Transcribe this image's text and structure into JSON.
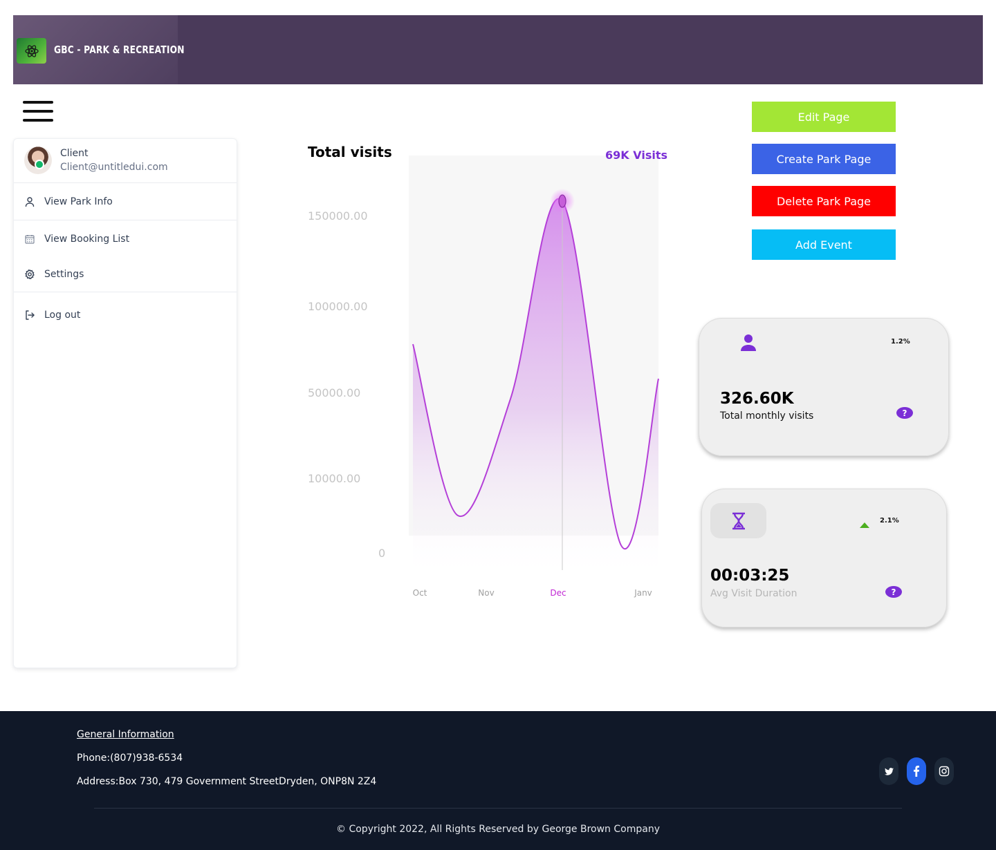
{
  "header": {
    "logo_text": "GBC - PARK & RECREATION",
    "background": "#4a3a5a"
  },
  "sidebar": {
    "user": {
      "name": "Client",
      "email": "Client@untitledui.com"
    },
    "items": [
      {
        "label": "View Park Info",
        "icon": "user-icon"
      },
      {
        "label": "View Booking List",
        "icon": "calendar-icon"
      },
      {
        "label": "Settings",
        "icon": "gear-icon"
      },
      {
        "label": "Log out",
        "icon": "logout-icon"
      }
    ]
  },
  "chart": {
    "title": "Total visits",
    "peak_label": "69K Visits"
  },
  "chart_data": {
    "type": "area",
    "title": "Total visits",
    "y_tick_labels": [
      "150000.00",
      "100000.00",
      "50000.00",
      "10000.00",
      "0"
    ],
    "x_tick_labels": [
      "Oct",
      "Nov",
      "Dec",
      "Janv"
    ],
    "highlighted_category": "Dec",
    "annotation": "69K Visits",
    "series": [
      {
        "values": [
          {
            "x": "Oct",
            "y": 78000
          },
          {
            "x": "Oct-Nov",
            "y": 5000
          },
          {
            "x": "Nov",
            "y": 40000
          },
          {
            "x": "Nov-Dec",
            "y": 47000
          },
          {
            "x": "Dec",
            "y": 158000
          },
          {
            "x": "Dec-Janv",
            "y": 1000
          },
          {
            "x": "Janv",
            "y": 58000
          }
        ]
      }
    ],
    "colors": {
      "line": "#b43fd8",
      "fill": "#d9a3ec",
      "highlight": "#c026d3",
      "grid": "#eeeeee"
    },
    "grid": false
  },
  "actions": {
    "edit": "Edit Page",
    "create": "Create Park Page",
    "delete": "Delete Park Page",
    "add_event": "Add Event"
  },
  "action_colors": {
    "edit": "#a3e635",
    "create": "#3b63e6",
    "delete": "#ff0000",
    "add_event": "#06bdf5"
  },
  "stats": {
    "visits": {
      "value": "326.60K",
      "label": "Total monthly visits",
      "change": "1.2%",
      "icon": "user-icon"
    },
    "duration": {
      "value": "00:03:25",
      "label": "Avg Visit Duration",
      "change": "2.1%",
      "icon": "hourglass-icon",
      "trend_icon": "triangle-up-icon"
    }
  },
  "footer": {
    "general_info": "General Information",
    "phone": "Phone:(807)938-6534",
    "address": "Address:Box 730, 479 Government StreetDryden, ONP8N 2Z4",
    "copyright": "© Copyright 2022, All Rights Reserved by George Brown Company",
    "social": [
      "twitter-icon",
      "facebook-icon",
      "instagram-icon"
    ],
    "background": "#101828"
  }
}
